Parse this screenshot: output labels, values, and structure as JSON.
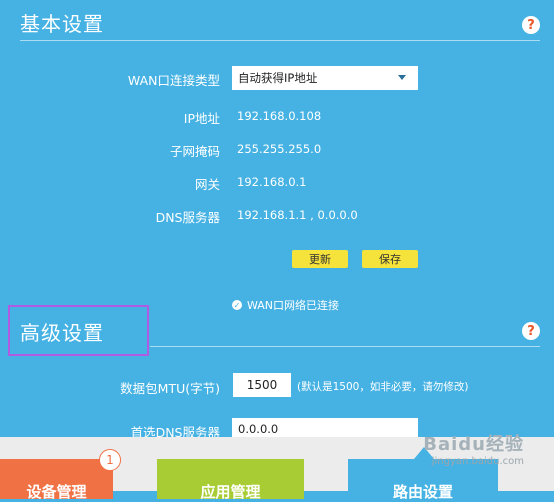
{
  "basic": {
    "title": "基本设置",
    "help": "?",
    "wan_type_label": "WAN口连接类型",
    "wan_type_value": "自动获得IP地址",
    "ip_label": "IP地址",
    "ip_value": "192.168.0.108",
    "mask_label": "子网掩码",
    "mask_value": "255.255.255.0",
    "gateway_label": "网关",
    "gateway_value": "192.168.0.1",
    "dns_label": "DNS服务器",
    "dns_value": "192.168.1.1 , 0.0.0.0",
    "refresh_label": "更新",
    "save_label": "保存",
    "status_text": "WAN口网络已连接"
  },
  "advanced": {
    "title": "高级设置",
    "help": "?",
    "mtu_label": "数据包MTU(字节)",
    "mtu_value": "1500",
    "mtu_hint": "(默认是1500，如非必要，请勿修改)",
    "primary_dns_label": "首选DNS服务器",
    "primary_dns_value": "0.0.0.0"
  },
  "bottom_nav": {
    "device_label": "设备管理",
    "device_badge": "1",
    "app_label": "应用管理",
    "route_label": "路由设置"
  },
  "watermark": {
    "brand": "Baidu经验",
    "url": "jingyan.baidu.com"
  },
  "colors": {
    "background": "#45b2e3",
    "button": "#f5e23a",
    "highlight": "#b05ce2",
    "device_tile": "#f07144",
    "app_tile": "#a8cc34"
  }
}
